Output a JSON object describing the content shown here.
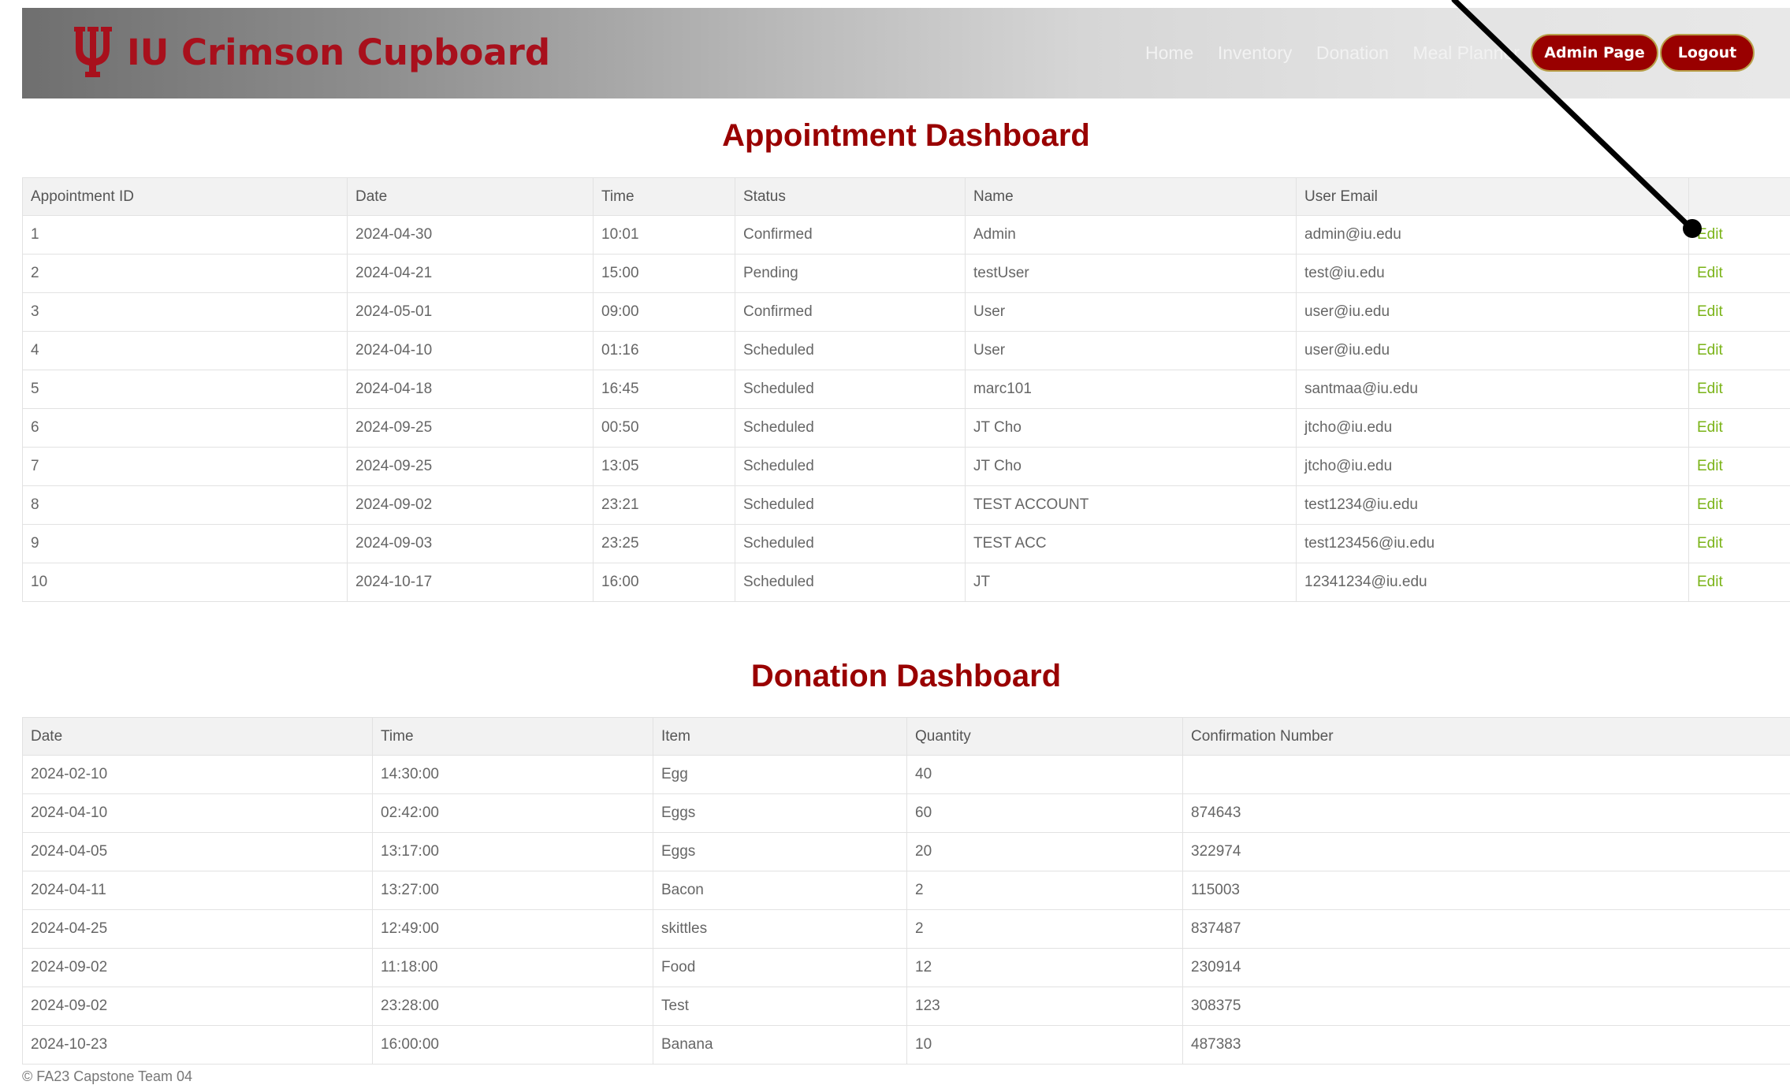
{
  "brand": {
    "name": "IU Crimson Cupboard",
    "logo_color": "#a8101c"
  },
  "nav": {
    "links": [
      "Home",
      "Inventory",
      "Donation",
      "Meal Planner"
    ],
    "admin_button": "Admin Page",
    "logout_button": "Logout"
  },
  "appointments": {
    "title": "Appointment Dashboard",
    "columns": [
      "Appointment ID",
      "Date",
      "Time",
      "Status",
      "Name",
      "User Email",
      ""
    ],
    "rows": [
      [
        "1",
        "2024-04-30",
        "10:01",
        "Confirmed",
        "Admin",
        "admin@iu.edu",
        "Edit"
      ],
      [
        "2",
        "2024-04-21",
        "15:00",
        "Pending",
        "testUser",
        "test@iu.edu",
        "Edit"
      ],
      [
        "3",
        "2024-05-01",
        "09:00",
        "Confirmed",
        "User",
        "user@iu.edu",
        "Edit"
      ],
      [
        "4",
        "2024-04-10",
        "01:16",
        "Scheduled",
        "User",
        "user@iu.edu",
        "Edit"
      ],
      [
        "5",
        "2024-04-18",
        "16:45",
        "Scheduled",
        "marc101",
        "santmaa@iu.edu",
        "Edit"
      ],
      [
        "6",
        "2024-09-25",
        "00:50",
        "Scheduled",
        "JT Cho",
        "jtcho@iu.edu",
        "Edit"
      ],
      [
        "7",
        "2024-09-25",
        "13:05",
        "Scheduled",
        "JT Cho",
        "jtcho@iu.edu",
        "Edit"
      ],
      [
        "8",
        "2024-09-02",
        "23:21",
        "Scheduled",
        "TEST ACCOUNT",
        "test1234@iu.edu",
        "Edit"
      ],
      [
        "9",
        "2024-09-03",
        "23:25",
        "Scheduled",
        "TEST ACC",
        "test123456@iu.edu",
        "Edit"
      ],
      [
        "10",
        "2024-10-17",
        "16:00",
        "Scheduled",
        "JT",
        "12341234@iu.edu",
        "Edit"
      ]
    ]
  },
  "donations": {
    "title": "Donation Dashboard",
    "columns": [
      "Date",
      "Time",
      "Item",
      "Quantity",
      "Confirmation Number"
    ],
    "rows": [
      [
        "2024-02-10",
        "14:30:00",
        "Egg",
        "40",
        ""
      ],
      [
        "2024-04-10",
        "02:42:00",
        "Eggs",
        "60",
        "874643"
      ],
      [
        "2024-04-05",
        "13:17:00",
        "Eggs",
        "20",
        "322974"
      ],
      [
        "2024-04-11",
        "13:27:00",
        "Bacon",
        "2",
        "115003"
      ],
      [
        "2024-04-25",
        "12:49:00",
        "skittles",
        "2",
        "837487"
      ],
      [
        "2024-09-02",
        "11:18:00",
        "Food",
        "12",
        "230914"
      ],
      [
        "2024-09-02",
        "23:28:00",
        "Test",
        "123",
        "308375"
      ],
      [
        "2024-10-23",
        "16:00:00",
        "Banana",
        "10",
        "487383"
      ]
    ]
  },
  "footer": {
    "text": "© FA23 Capstone Team 04"
  },
  "colors": {
    "crimson": "#990000",
    "edit_link": "#7ab317"
  }
}
